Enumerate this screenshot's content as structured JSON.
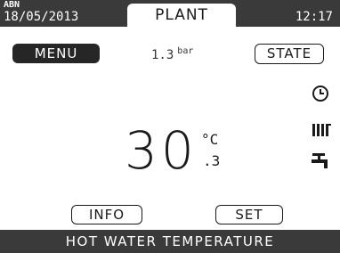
{
  "header": {
    "code": "ABN",
    "date": "18/05/2013",
    "tab_label": "PLANT",
    "time": "12:17"
  },
  "toolbar": {
    "menu_label": "MENU",
    "pressure_value": "1.3",
    "pressure_unit": "bar",
    "state_label": "STATE"
  },
  "icons": {
    "status": [
      "clock-icon",
      "radiator-icon",
      "tap-icon"
    ]
  },
  "main": {
    "temperature_whole": "30",
    "temperature_unit": "°C",
    "temperature_decimal": ".3"
  },
  "actions": {
    "info_label": "INFO",
    "set_label": "SET"
  },
  "footer": {
    "label": "HOT WATER TEMPERATURE"
  },
  "colors": {
    "bar_background": "#3a3a3a",
    "menu_background": "#262626",
    "screen_background": "#ffffff",
    "text": "#1a1a1a"
  }
}
